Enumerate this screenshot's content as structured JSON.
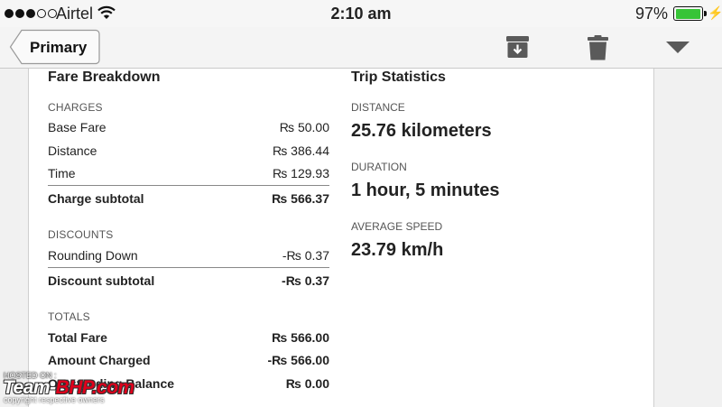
{
  "status_bar": {
    "carrier": "Airtel",
    "time": "2:10 am",
    "battery_percent": "97%",
    "battery_level": 0.97,
    "signal_bars_filled": 3,
    "signal_bars_total": 5
  },
  "nav": {
    "back_label": "Primary",
    "icons": [
      "archive-icon",
      "trash-icon",
      "more-dropdown-icon"
    ]
  },
  "fare": {
    "title": "Fare Breakdown",
    "charges_label": "CHARGES",
    "base_fare_label": "Base Fare",
    "base_fare_value": "₨ 50.00",
    "distance_label": "Distance",
    "distance_value": "₨ 386.44",
    "time_label": "Time",
    "time_value": "₨ 129.93",
    "charge_subtotal_label": "Charge subtotal",
    "charge_subtotal_value": "₨ 566.37",
    "discounts_label": "DISCOUNTS",
    "rounding_label": "Rounding Down",
    "rounding_value": "-₨ 0.37",
    "discount_subtotal_label": "Discount subtotal",
    "discount_subtotal_value": "-₨ 0.37",
    "totals_label": "TOTALS",
    "total_fare_label": "Total Fare",
    "total_fare_value": "₨ 566.00",
    "amount_charged_label": "Amount Charged",
    "amount_charged_value": "-₨ 566.00",
    "outstanding_label": "Outstanding Balance",
    "outstanding_value": "₨ 0.00"
  },
  "trip": {
    "title": "Trip Statistics",
    "distance_label": "DISTANCE",
    "distance_value": "25.76 kilometers",
    "duration_label": "DURATION",
    "duration_value": "1 hour, 5 minutes",
    "speed_label": "AVERAGE SPEED",
    "speed_value": "23.79 km/h"
  },
  "watermark": {
    "hosted_on": "HOSTED ON :",
    "logo_prefix": "Team-",
    "logo_suffix": "BHP.com",
    "copyright": "copyright respective owners"
  },
  "colors": {
    "battery_green": "#37c437",
    "logo_red": "#e0001b"
  }
}
